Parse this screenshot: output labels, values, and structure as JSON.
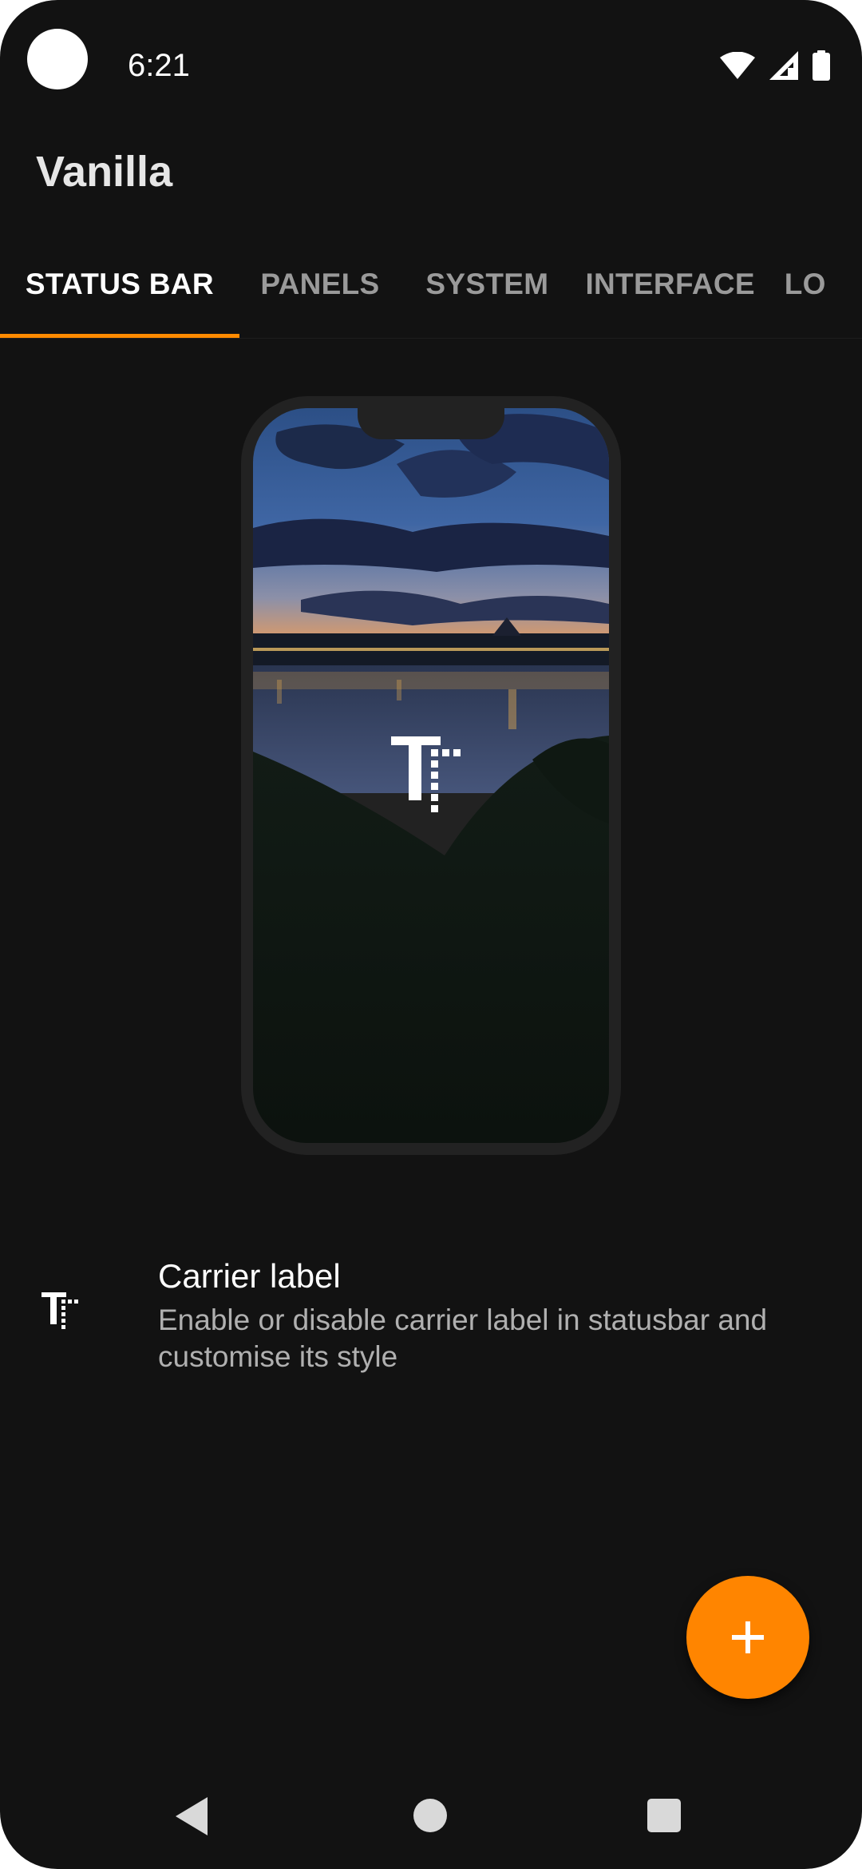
{
  "status_bar": {
    "time": "6:21",
    "icons": [
      "camera-cutout",
      "wifi-icon",
      "cell-signal-icon",
      "battery-icon"
    ]
  },
  "app": {
    "title": "Vanilla"
  },
  "tabs": [
    {
      "label": "STATUS BAR",
      "active": true
    },
    {
      "label": "PANELS",
      "active": false
    },
    {
      "label": "SYSTEM",
      "active": false
    },
    {
      "label": "INTERFACE",
      "active": false
    },
    {
      "label": "LO",
      "active": false
    }
  ],
  "preview": {
    "image": "night-lake-cityscape",
    "logo_icon": "carrier-label-icon"
  },
  "preferences": [
    {
      "icon": "carrier-label-icon",
      "title": "Carrier label",
      "summary": "Enable or disable carrier label in statusbar and customise its style"
    }
  ],
  "fab": {
    "icon": "plus-icon"
  },
  "nav_bar": {
    "icons": [
      "back-icon",
      "home-icon",
      "recents-icon"
    ]
  },
  "colors": {
    "background": "#121212",
    "accent": "#ff8500",
    "text_primary": "#ffffff",
    "text_secondary": "#b0b0b0",
    "tab_inactive": "#9a9a9a"
  }
}
